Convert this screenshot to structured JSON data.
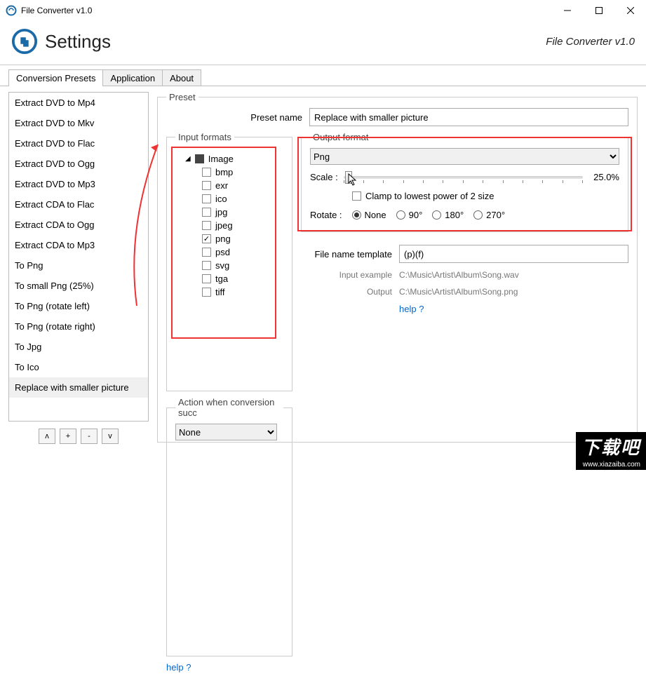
{
  "window": {
    "title": "File Converter v1.0"
  },
  "header": {
    "heading": "Settings",
    "brand": "File Converter v1.0"
  },
  "tabs": [
    "Conversion Presets",
    "Application",
    "About"
  ],
  "presets": [
    "Extract DVD to Mp4",
    "Extract DVD to Mkv",
    "Extract DVD to Flac",
    "Extract DVD to Ogg",
    "Extract DVD to Mp3",
    "Extract CDA to Flac",
    "Extract CDA to Ogg",
    "Extract CDA to Mp3",
    "To Png",
    "To small Png (25%)",
    "To Png (rotate left)",
    "To Png (rotate right)",
    "To Jpg",
    "To Ico",
    "Replace with smaller picture"
  ],
  "selected_preset_index": 14,
  "btns": {
    "up": "ʌ",
    "add": "+",
    "remove": "-",
    "down": "v"
  },
  "preset": {
    "legend": "Preset",
    "name_label": "Preset name",
    "name_value": "Replace with smaller picture",
    "input_formats_legend": "Input formats",
    "tree_root": "Image",
    "tree_items": [
      "bmp",
      "exr",
      "ico",
      "jpg",
      "jpeg",
      "png",
      "psd",
      "svg",
      "tga",
      "tiff"
    ],
    "tree_checked": "png",
    "action_legend": "Action when conversion succ",
    "action_value": "None",
    "help": "help ?",
    "output_legend": "Output format",
    "output_value": "Png",
    "scale_label": "Scale :",
    "scale_value": "25.0%",
    "clamp_label": "Clamp to lowest power of 2 size",
    "rotate_label": "Rotate :",
    "rotate_options": [
      "None",
      "90°",
      "180°",
      "270°"
    ],
    "rotate_selected": "None",
    "template_label": "File name template",
    "template_value": "(p)(f)",
    "example_label": "Input example",
    "example_value": "C:\\Music\\Artist\\Album\\Song.wav",
    "output_label": "Output",
    "output_path": "C:\\Music\\Artist\\Album\\Song.png"
  },
  "close": "Close",
  "watermark": {
    "big": "下载吧",
    "url": "www.xiazaiba.com"
  }
}
